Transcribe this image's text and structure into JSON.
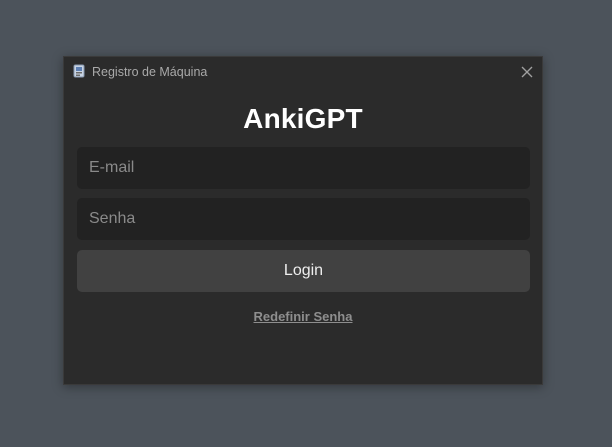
{
  "window": {
    "title": "Registro de Máquina",
    "app_icon": "app-icon",
    "close_icon": "close-icon"
  },
  "form": {
    "heading": "AnkiGPT",
    "email_placeholder": "E-mail",
    "email_value": "",
    "password_placeholder": "Senha",
    "password_value": "",
    "login_label": "Login",
    "reset_label": "Redefinir Senha"
  },
  "colors": {
    "desktop_background": "#4c535b",
    "dialog_background": "#2b2b2b",
    "input_background": "#222222",
    "button_background": "#414141",
    "heading_text": "#ffffff",
    "link_text": "#8e8e8e"
  }
}
